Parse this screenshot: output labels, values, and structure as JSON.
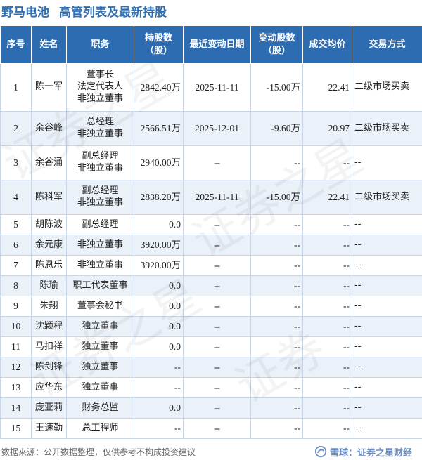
{
  "header": {
    "company": "野马电池",
    "title": "高管列表及最新持股"
  },
  "table": {
    "columns": [
      "序号",
      "姓名",
      "职务",
      "持股数\n（股）",
      "最近变动日期",
      "变动股数\n（股）",
      "成交均价",
      "交易方式"
    ],
    "rows": [
      {
        "no": "1",
        "name": "陈一军",
        "position": [
          "董事长",
          "法定代表人",
          "非独立董事"
        ],
        "shares": "2842.40万",
        "date": "2025-11-11",
        "change": "-15.00万",
        "price": "22.41",
        "method": "二级市场买卖"
      },
      {
        "no": "2",
        "name": "余谷峰",
        "position": [
          "总经理",
          "非独立董事"
        ],
        "shares": "2566.51万",
        "date": "2025-12-01",
        "change": "-9.60万",
        "price": "20.97",
        "method": "二级市场买卖"
      },
      {
        "no": "3",
        "name": "余谷涌",
        "position": [
          "副总经理",
          "非独立董事"
        ],
        "shares": "2940.00万",
        "date": "--",
        "change": "--",
        "price": "--",
        "method": "--"
      },
      {
        "no": "4",
        "name": "陈科军",
        "position": [
          "副总经理",
          "非独立董事"
        ],
        "shares": "2838.20万",
        "date": "2025-11-11",
        "change": "-15.00万",
        "price": "22.41",
        "method": "二级市场买卖"
      },
      {
        "no": "5",
        "name": "胡陈波",
        "position": [
          "副总经理"
        ],
        "shares": "0.0",
        "date": "--",
        "change": "--",
        "price": "--",
        "method": "--"
      },
      {
        "no": "6",
        "name": "余元康",
        "position": [
          "非独立董事"
        ],
        "shares": "3920.00万",
        "date": "--",
        "change": "--",
        "price": "--",
        "method": "--"
      },
      {
        "no": "7",
        "name": "陈恩乐",
        "position": [
          "非独立董事"
        ],
        "shares": "3920.00万",
        "date": "--",
        "change": "--",
        "price": "--",
        "method": "--"
      },
      {
        "no": "8",
        "name": "陈瑜",
        "position": [
          "职工代表董事"
        ],
        "shares": "0.0",
        "date": "--",
        "change": "--",
        "price": "--",
        "method": "--"
      },
      {
        "no": "9",
        "name": "朱翔",
        "position": [
          "董事会秘书"
        ],
        "shares": "0.0",
        "date": "--",
        "change": "--",
        "price": "--",
        "method": "--"
      },
      {
        "no": "10",
        "name": "沈颖程",
        "position": [
          "独立董事"
        ],
        "shares": "0.0",
        "date": "--",
        "change": "--",
        "price": "--",
        "method": "--"
      },
      {
        "no": "11",
        "name": "马扣祥",
        "position": [
          "独立董事"
        ],
        "shares": "0.0",
        "date": "--",
        "change": "--",
        "price": "--",
        "method": "--"
      },
      {
        "no": "12",
        "name": "陈剑锋",
        "position": [
          "独立董事"
        ],
        "shares": "--",
        "date": "--",
        "change": "--",
        "price": "--",
        "method": "--"
      },
      {
        "no": "13",
        "name": "应华东",
        "position": [
          "独立董事"
        ],
        "shares": "--",
        "date": "--",
        "change": "--",
        "price": "--",
        "method": "--"
      },
      {
        "no": "14",
        "name": "庞亚莉",
        "position": [
          "财务总监"
        ],
        "shares": "0.0",
        "date": "--",
        "change": "--",
        "price": "--",
        "method": "--"
      },
      {
        "no": "15",
        "name": "王速勤",
        "position": [
          "总工程师"
        ],
        "shares": "--",
        "date": "--",
        "change": "--",
        "price": "--",
        "method": "--"
      }
    ]
  },
  "footer": {
    "source": "数据来源：公开数据整理，仅供参考不构成投资建议",
    "brand": "雪球：证券之星财经"
  },
  "colors": {
    "header_bg": "#2e6cb2",
    "title": "#2f6fb4",
    "negative": "#2a9a3b",
    "stripe": "#eaf1f9"
  },
  "icons": {
    "brand_logo": "snowball-logo-icon"
  }
}
